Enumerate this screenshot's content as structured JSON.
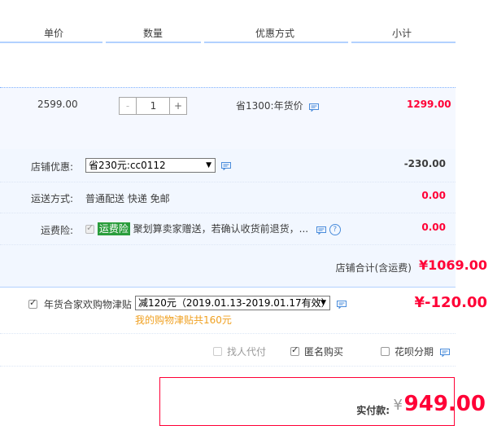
{
  "header": {
    "col_price": "单价",
    "col_qty": "数量",
    "col_promo": "优惠方式",
    "col_subtotal": "小计"
  },
  "item": {
    "price": "2599.00",
    "qty_minus": "-",
    "qty_value": "1",
    "qty_plus": "+",
    "promo": "省1300:年货价",
    "subtotal": "1299.00"
  },
  "shop": {
    "discount_label": "店铺优惠:",
    "discount_selected": "省230元:cc0112",
    "discount_amount": "-230.00",
    "shipping_label": "运送方式:",
    "shipping_value": "普通配送 快递 免邮",
    "shipping_amount": "0.00",
    "insurance_label": "运费险:",
    "insurance_tag": "运费险",
    "insurance_text": "聚划算卖家赠送，若确认收货前退货，...",
    "insurance_amount": "0.00",
    "total_label": "店铺合计(含运费)",
    "total_amount": "¥1069.00"
  },
  "allowance": {
    "label": "年货合家欢购物津贴",
    "selected": "减120元（2019.01.13-2019.01.17有效）",
    "amount": "¥-120.00",
    "note": "我的购物津贴共160元"
  },
  "options": {
    "proxy": "找人代付",
    "anonymous": "匿名购买",
    "installment": "花呗分期"
  },
  "payment": {
    "label": "实付款:",
    "currency": "¥",
    "amount": "949.00"
  },
  "colors": {
    "accent_red": "#ff0036",
    "link_blue": "#4a8cdb",
    "row_bg": "#f2f7ff",
    "note_orange": "#f0a020"
  }
}
